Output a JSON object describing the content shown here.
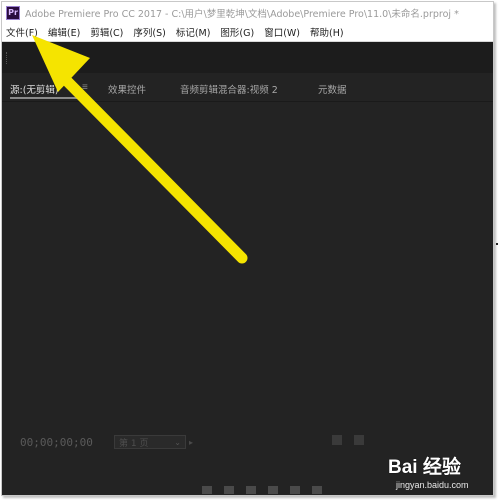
{
  "window": {
    "app_icon_text": "Pr",
    "title": "Adobe Premiere Pro CC 2017 - C:\\用户\\梦里乾坤\\文档\\Adobe\\Premiere Pro\\11.0\\未命名.prproj *"
  },
  "menu": {
    "items": [
      {
        "label": "文件(F)"
      },
      {
        "label": "编辑(E)"
      },
      {
        "label": "剪辑(C)"
      },
      {
        "label": "序列(S)"
      },
      {
        "label": "标记(M)"
      },
      {
        "label": "图形(G)"
      },
      {
        "label": "窗口(W)"
      },
      {
        "label": "帮助(H)"
      }
    ]
  },
  "panel": {
    "tabs": [
      {
        "label": "源:(无剪辑)",
        "active": true
      },
      {
        "label": "效果控件"
      },
      {
        "label": "音频剪辑混合器:视频 2"
      },
      {
        "label": "元数据"
      }
    ],
    "tab_menu_icon": "≡"
  },
  "monitor": {
    "timecode": "00;00;00;00",
    "page_select": "第 1 页",
    "page_arrow": "▸"
  },
  "watermark": {
    "brand": "Bai 经验",
    "url": "jingyan.baidu.com"
  },
  "annotation": {
    "arrow_color": "#f5e400"
  }
}
